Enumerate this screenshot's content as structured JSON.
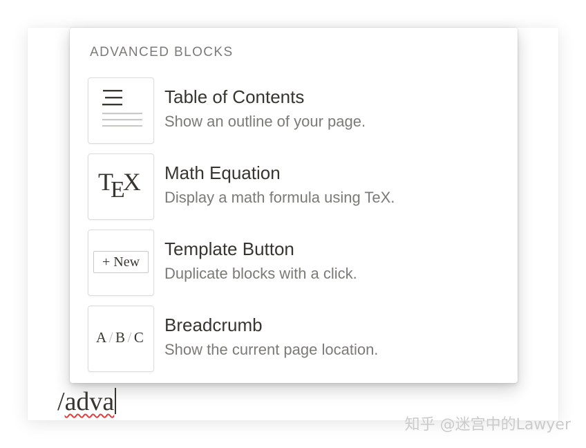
{
  "menu": {
    "section_header": "ADVANCED BLOCKS",
    "items": [
      {
        "title": "Table of Contents",
        "description": "Show an outline of your page.",
        "icon": "table-of-contents-icon"
      },
      {
        "title": "Math Equation",
        "description": "Display a math formula using TeX.",
        "icon": "tex-icon"
      },
      {
        "title": "Template Button",
        "description": "Duplicate blocks with a click.",
        "icon": "template-button-icon"
      },
      {
        "title": "Breadcrumb",
        "description": "Show the current page location.",
        "icon": "breadcrumb-icon"
      }
    ]
  },
  "thumbnails": {
    "tex": {
      "t": "T",
      "e": "E",
      "x": "X"
    },
    "template_button": "+ New",
    "breadcrumb": {
      "a": "A",
      "b": "B",
      "c": "C",
      "sep": "/"
    }
  },
  "editor": {
    "slash": "/",
    "query": "adva"
  },
  "watermark": "知乎 @迷宫中的Lawyer",
  "colors": {
    "text": "#37352f",
    "muted": "#7b7a76",
    "spellcheck": "#e03e3e"
  }
}
